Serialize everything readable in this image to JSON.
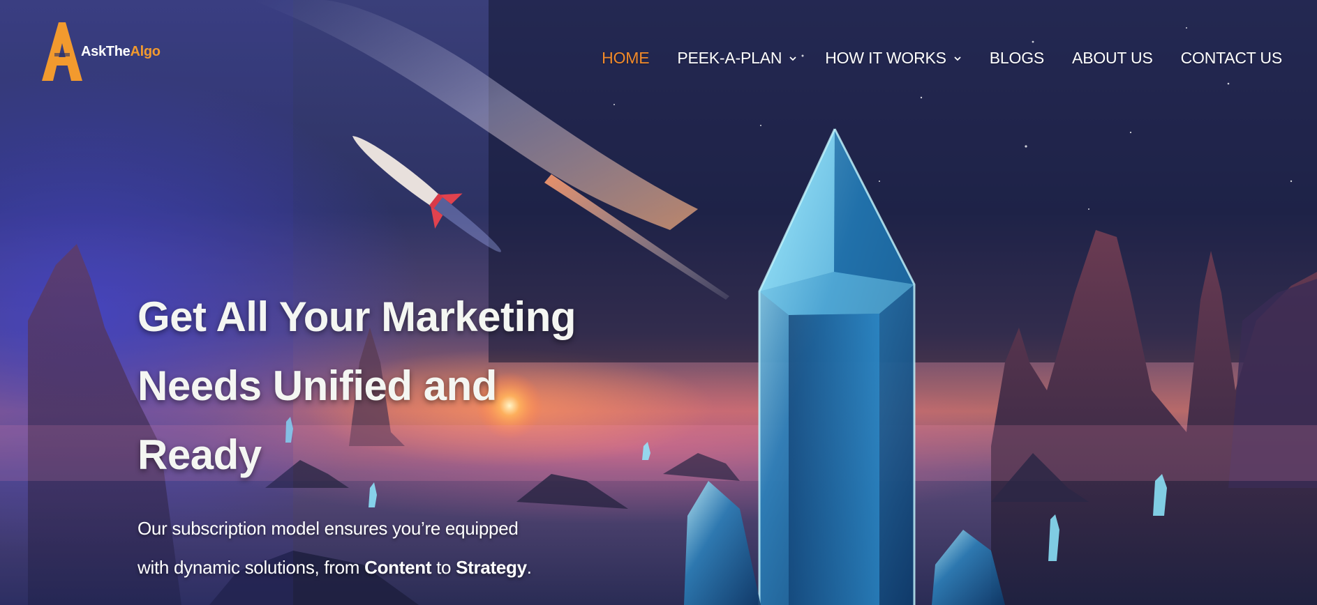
{
  "brand": {
    "name_part1": "AskThe",
    "name_part2": "Algo",
    "accent_color": "#f29a2e"
  },
  "nav": {
    "items": [
      {
        "label": "HOME",
        "active": true,
        "has_dropdown": false
      },
      {
        "label": "PEEK-A-PLAN",
        "active": false,
        "has_dropdown": true
      },
      {
        "label": "HOW IT WORKS",
        "active": false,
        "has_dropdown": true
      },
      {
        "label": "BLOGS",
        "active": false,
        "has_dropdown": false
      },
      {
        "label": "ABOUT US",
        "active": false,
        "has_dropdown": false
      },
      {
        "label": "CONTACT US",
        "active": false,
        "has_dropdown": false
      }
    ],
    "active_color": "#f28a2a",
    "text_color": "#ffffff",
    "dropdown_icon": "chevron-down-icon"
  },
  "hero": {
    "headline_line1": "Get All Your Marketing",
    "headline_line2": "Needs Unified and",
    "headline_line3": "Ready",
    "sub_line1": "Our subscription model ensures you’re equipped",
    "sub_line2_prefix": "with dynamic solutions, from ",
    "sub_bold1": "Content",
    "sub_mid": " to ",
    "sub_bold2": "Strategy",
    "sub_end": ".",
    "background": "hero-illustration-crystal-rocket-landscape"
  }
}
